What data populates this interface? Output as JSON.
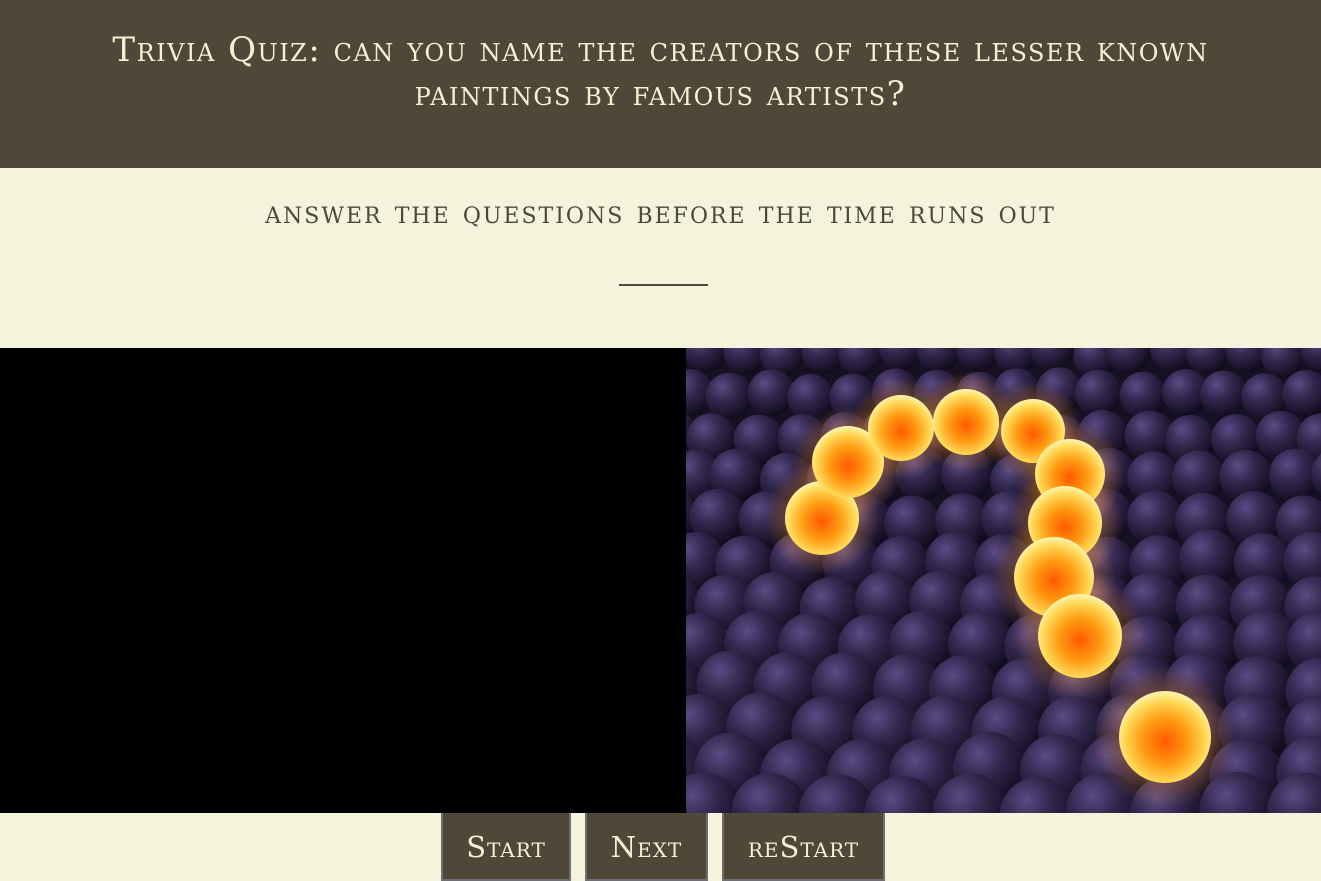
{
  "header": {
    "title": "Trivia Quiz: can you name the creators of these lesser known paintings by famous artists?"
  },
  "subheader": {
    "subtitle": "answer the questions before the time runs out"
  },
  "controls": {
    "start_label": "Start",
    "next_label": "Next",
    "restart_label": "reStart"
  },
  "colors": {
    "header_bg": "#4f4738",
    "page_bg": "#f4f3dc",
    "accent_text": "#f4f0d2",
    "glow": "#ff8a1a",
    "sphere": "#2c2246"
  },
  "image": {
    "name": "glowing-question-mark-spheres"
  }
}
